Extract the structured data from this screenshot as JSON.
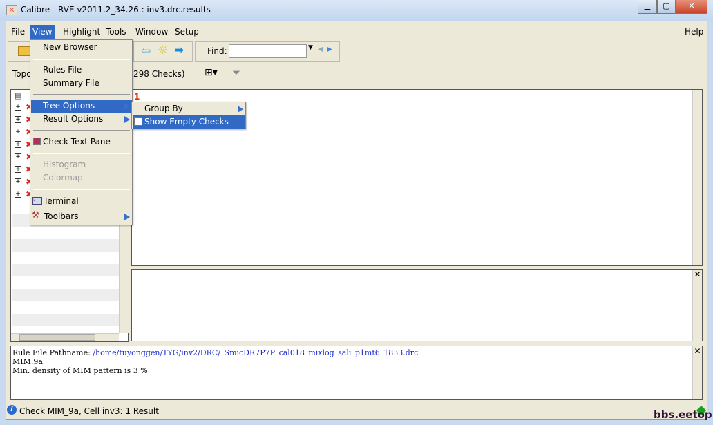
{
  "window": {
    "title": "Calibre - RVE v2011.2_34.26 : inv3.drc.results"
  },
  "menubar": {
    "items": [
      "File",
      "View",
      "Highlight",
      "Tools",
      "Window",
      "Setup"
    ],
    "help": "Help"
  },
  "toolbar": {
    "find_label": "Find:",
    "find_value": ""
  },
  "tree_header": {
    "prefix": "Topo",
    "checks": "298 Checks)"
  },
  "main": {
    "result_number": "1"
  },
  "view_menu": {
    "new_browser": "New Browser",
    "rules_file": "Rules File",
    "summary_file": "Summary File",
    "tree_options": "Tree Options",
    "result_options": "Result Options",
    "check_text_pane": "Check Text Pane",
    "histogram": "Histogram",
    "colormap": "Colormap",
    "terminal": "Terminal",
    "toolbars": "Toolbars"
  },
  "tree_options_submenu": {
    "group_by": "Group By",
    "show_empty_checks": "Show Empty Checks"
  },
  "check_text": {
    "path_label": "Rule File Pathname:",
    "path_value": "/home/tuyonggen/TYG/inv2/DRC/_SmicDR7P7P_cal018_mixlog_sali_p1mt6_1833.drc_",
    "line2": "MIM.9a",
    "line3": "Min. density of MIM pattern is 3 %"
  },
  "status": {
    "text": "Check MIM_9a, Cell inv3: 1 Result"
  },
  "watermark": "bbs.eetop.cn"
}
